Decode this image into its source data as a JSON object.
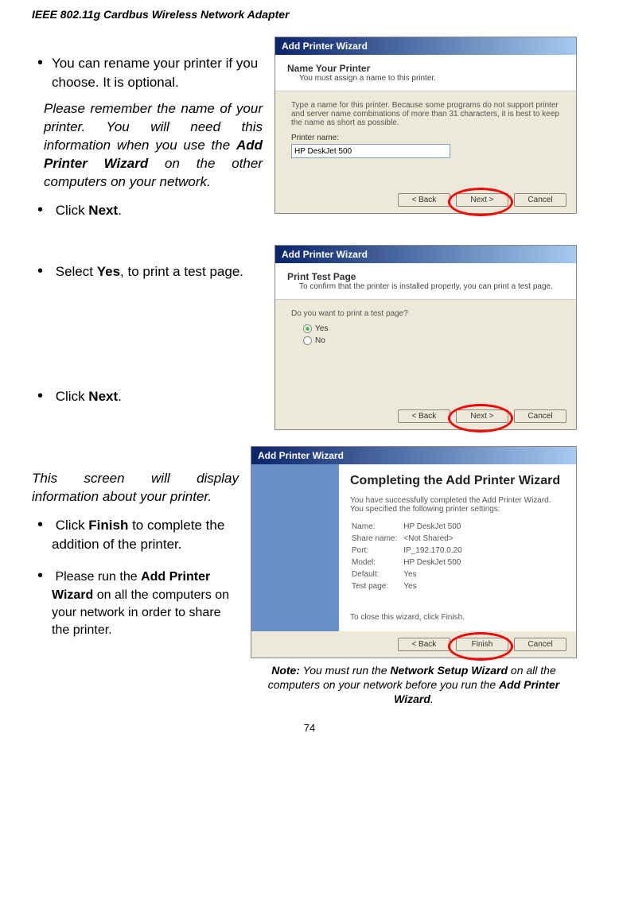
{
  "header": "IEEE 802.11g Cardbus Wireless Network Adapter",
  "section1": {
    "bullet1a": "You can rename your printer if you choose. It is optional.",
    "note_prefix": "Please remember the name of your printer.  You will need this information when you use the ",
    "note_bold": "Add Printer Wizard",
    "note_suffix": " on the other computers on your network.",
    "bullet1b_pre": "Click ",
    "bullet1b_bold": "Next",
    "bullet1b_post": "."
  },
  "dialog1": {
    "title": "Add Printer Wizard",
    "header": "Name Your Printer",
    "sub": "You must assign a name to this printer.",
    "desc": "Type a name for this printer. Because some programs do not support printer and server name combinations of more than 31 characters, it is best to keep the name as short as possible.",
    "label": "Printer name:",
    "value": "HP DeskJet 500",
    "back": "< Back",
    "next": "Next >",
    "cancel": "Cancel"
  },
  "section2": {
    "bullet2a_pre": "Select ",
    "bullet2a_bold": "Yes",
    "bullet2a_post": ", to print a test page.",
    "bullet2b_pre": "Click ",
    "bullet2b_bold": "Next",
    "bullet2b_post": "."
  },
  "dialog2": {
    "title": "Add Printer Wizard",
    "header": "Print Test Page",
    "sub": "To confirm that the printer is installed properly, you can print a test page.",
    "question": "Do you want to print a test page?",
    "yes": "Yes",
    "no": "No",
    "back": "< Back",
    "next": "Next >",
    "cancel": "Cancel"
  },
  "section3": {
    "note": "This screen will display information about your printer.",
    "bullet3a_pre": "Click ",
    "bullet3a_bold": "Finish",
    "bullet3a_post": " to complete the addition of the printer.",
    "bullet3b_pre": "Please run the ",
    "bullet3b_bold": "Add Printer Wizard",
    "bullet3b_post": " on all the computers on your network in order to share the printer."
  },
  "dialog3": {
    "title": "Add Printer Wizard",
    "complete": "Completing the Add Printer Wizard",
    "sub": "You have successfully completed the Add Printer Wizard. You specified the following printer settings:",
    "rows": [
      [
        "Name:",
        "HP DeskJet 500"
      ],
      [
        "Share name:",
        "<Not Shared>"
      ],
      [
        "Port:",
        "IP_192.170.0.20"
      ],
      [
        "Model:",
        "HP DeskJet 500"
      ],
      [
        "Default:",
        "Yes"
      ],
      [
        "Test page:",
        "Yes"
      ]
    ],
    "close": "To close this wizard, click Finish.",
    "back": "< Back",
    "finish": "Finish",
    "cancel": "Cancel"
  },
  "footer": {
    "note_bold1": "Note:",
    "note_text1": " You must run the ",
    "note_bold2": "Network Setup Wizard",
    "note_text2": " on all the computers on your network before you run the ",
    "note_bold3": "Add Printer Wizard",
    "note_text3": "."
  },
  "page": "74"
}
